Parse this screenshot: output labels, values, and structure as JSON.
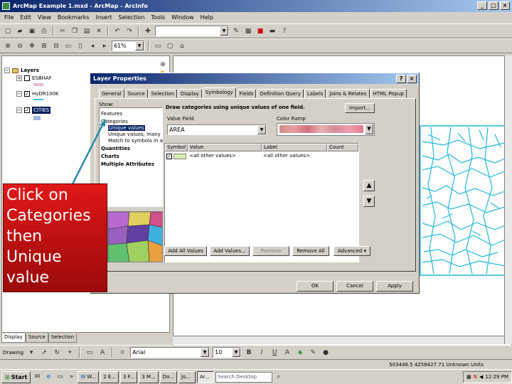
{
  "window": {
    "title": "ArcMap Example 1.mxd - ArcMap - ArcInfo"
  },
  "menu": [
    "File",
    "Edit",
    "View",
    "Bookmarks",
    "Insert",
    "Selection",
    "Tools",
    "Window",
    "Help"
  ],
  "toolbar2": {
    "scale_value": ""
  },
  "toolbar3": {
    "zoom_value": "61%"
  },
  "toc": {
    "root_label": "Layers",
    "layers": [
      {
        "name": "ESBHAF",
        "checked": false,
        "swatch_color": "#e8b8d0"
      },
      {
        "name": "HyDR100K",
        "checked": true,
        "swatch_color": "#40c0e0"
      },
      {
        "name": "CITIES",
        "checked": true,
        "swatch_color": "#a0b8e0"
      }
    ],
    "tabs": [
      "Display",
      "Source",
      "Selection"
    ]
  },
  "dialog": {
    "title": "Layer Properties",
    "help_label": "?",
    "close_label": "×",
    "tabs": [
      "General",
      "Source",
      "Selection",
      "Display",
      "Symbology",
      "Fields",
      "Definition Query",
      "Labels",
      "Joins & Relates",
      "HTML Popup"
    ],
    "active_tab": "Symbology",
    "show_label": "Show:",
    "show_tree": [
      {
        "label": "Features",
        "bold": false
      },
      {
        "label": "Categories",
        "bold": false
      },
      {
        "label": "Unique values",
        "bold": false,
        "selected": true
      },
      {
        "label": "Unique values, many",
        "bold": false
      },
      {
        "label": "Match to symbols in a",
        "bold": false
      },
      {
        "label": "Quantities",
        "bold": true
      },
      {
        "label": "Charts",
        "bold": true
      },
      {
        "label": "Multiple Attributes",
        "bold": true
      }
    ],
    "heading": "Draw categories using unique values of one field.",
    "import_label": "Import...",
    "value_field_label": "Value Field",
    "value_field_value": "AREA",
    "color_ramp_label": "Color Ramp",
    "table_headers": [
      "Symbol",
      "Value",
      "Label",
      "Count"
    ],
    "table_row": {
      "value": "<all other values>",
      "label": "<all other values>",
      "checked": true
    },
    "add_all_values": "Add All Values",
    "add_values": "Add Values...",
    "remove": "Remove",
    "remove_all": "Remove All",
    "advanced": "Advanced",
    "ok": "OK",
    "cancel": "Cancel",
    "apply": "Apply"
  },
  "callout": {
    "lines": [
      "Click on",
      "Categories",
      "then",
      "Unique",
      "value"
    ]
  },
  "drawbar": {
    "drawing_label": "Drawing",
    "font_name": "Arial",
    "font_size": "10"
  },
  "status": {
    "coords": "503446.5 4258427.71 Unknown Units"
  },
  "taskbar": {
    "start": "Start",
    "buttons": [
      "W...",
      "2 E...",
      "3 F...",
      "3 M...",
      "Do...",
      "Jo...",
      "Ar..."
    ],
    "search_placeholder": "Search Desktop",
    "clock": "12:29 PM"
  },
  "colors": {
    "river": "#1fb8d8",
    "title_blue": "#0a246a",
    "callout_red": "#d01010"
  }
}
